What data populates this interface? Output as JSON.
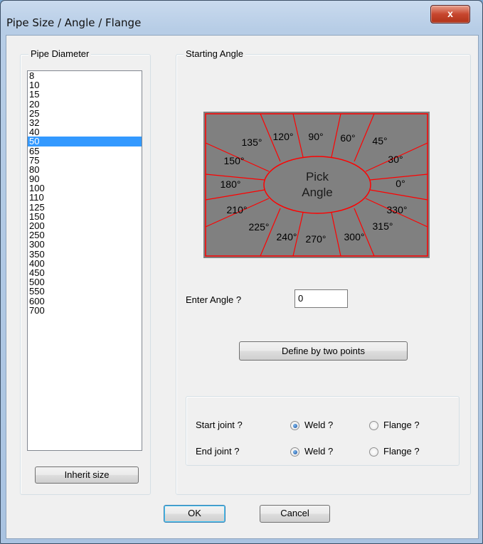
{
  "window": {
    "title": "Pipe Size / Angle / Flange",
    "close_label": "x"
  },
  "pipe_diameter": {
    "legend": "Pipe Diameter",
    "items": [
      "8",
      "10",
      "15",
      "20",
      "25",
      "32",
      "40",
      "50",
      "65",
      "75",
      "80",
      "90",
      "100",
      "110",
      "125",
      "150",
      "200",
      "250",
      "300",
      "350",
      "400",
      "450",
      "500",
      "550",
      "600",
      "700"
    ],
    "selected": "50",
    "inherit_button": "Inherit size"
  },
  "starting_angle": {
    "legend": "Starting Angle",
    "picker": {
      "center_text_line1": "Pick",
      "center_text_line2": "Angle",
      "angles": [
        "90°",
        "60°",
        "45°",
        "30°",
        "0°",
        "330°",
        "315°",
        "300°",
        "270°",
        "240°",
        "225°",
        "210°",
        "180°",
        "150°",
        "135°",
        "120°"
      ],
      "colors": {
        "background": "#808080",
        "lines": "#ff0000",
        "text": "#000000"
      }
    },
    "enter_angle_label": "Enter Angle ?",
    "enter_angle_value": "0",
    "define_button": "Define by two points"
  },
  "joints": {
    "start_label": "Start joint ?",
    "end_label": "End  joint ?",
    "weld_label": "Weld ?",
    "flange_label": "Flange ?",
    "start_selected": "weld",
    "end_selected": "weld"
  },
  "footer": {
    "ok": "OK",
    "cancel": "Cancel"
  }
}
